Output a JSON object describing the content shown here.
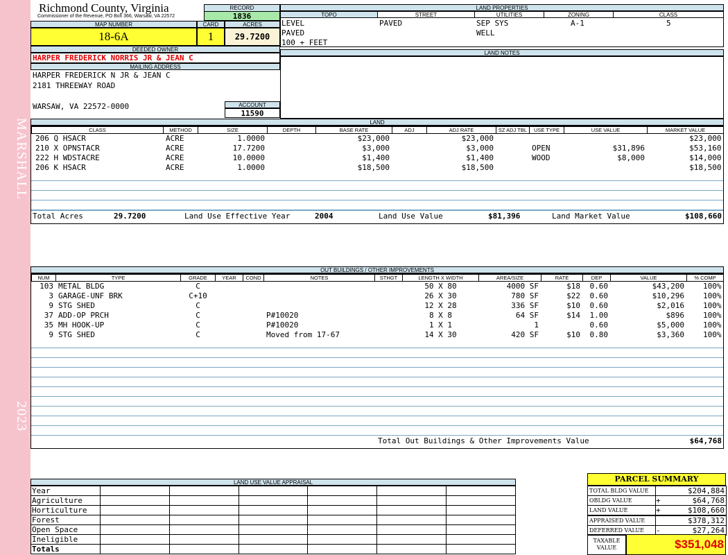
{
  "sidebar": {
    "top_text": "MARSHALL",
    "bottom_text": "2023",
    "color": "#f6c3cc"
  },
  "header": {
    "county": "Richmond County, Virginia",
    "sub": "Commissioner of the Revenue, PO Box 366, Warsaw, VA 22572",
    "record_label": "RECORD",
    "record": "1836",
    "map_number_label": "MAP NUMBER",
    "map_number": "18-6A",
    "card_label": "CARD",
    "card": "1",
    "acres_label": "ACRES",
    "acres": "29.7200"
  },
  "owner": {
    "deeded_label": "DEEDED OWNER",
    "deeded_owner": "HARPER FREDERICK NORRIS JR & JEAN C",
    "mailing_label": "MAILING ADDRESS",
    "mail_line1": "HARPER FREDERICK N JR & JEAN C",
    "mail_line2": "2181 THREEWAY ROAD",
    "mail_line3": "WARSAW, VA 22572-0000",
    "account_label": "ACCOUNT",
    "account": "11590"
  },
  "land_properties": {
    "title": "LAND PROPERTIES",
    "headers": [
      "TOPO",
      "STREET",
      "UTILITIES",
      "ZONING",
      "CLASS"
    ],
    "topo": [
      "LEVEL",
      "PAVED",
      "100 + FEET"
    ],
    "street": [
      "PAVED"
    ],
    "utilities": [
      "SEP SYS",
      "WELL"
    ],
    "zoning": "A-1",
    "class": "5"
  },
  "land_notes": {
    "title": "LAND NOTES"
  },
  "land": {
    "title": "LAND",
    "headers": [
      "CLASS",
      "METHOD",
      "SIZE",
      "DEPTH",
      "BASE RATE",
      "ADJ",
      "ADJ RATE",
      "SZ ADJ TBL",
      "USE TYPE",
      "USE VALUE",
      "MARKET VALUE"
    ],
    "rows": [
      [
        "206 Q HSACR",
        "ACRE",
        "1.0000",
        "",
        "$23,000",
        "",
        "$23,000",
        "",
        "",
        "",
        "$23,000"
      ],
      [
        "210 X OPNSTACR",
        "ACRE",
        "17.7200",
        "",
        "$3,000",
        "",
        "$3,000",
        "",
        "OPEN",
        "$31,896",
        "$53,160"
      ],
      [
        "222 H WDSTACRE",
        "ACRE",
        "10.0000",
        "",
        "$1,400",
        "",
        "$1,400",
        "",
        "WOOD",
        "$8,000",
        "$14,000"
      ],
      [
        "206 K HSACR",
        "ACRE",
        "1.0000",
        "",
        "$18,500",
        "",
        "$18,500",
        "",
        "",
        "",
        "$18,500"
      ]
    ],
    "total_acres_label": "Total Acres",
    "total_acres": "29.7200",
    "effective_year_label": "Land Use Effective Year",
    "effective_year": "2004",
    "use_value_label": "Land Use Value",
    "use_value": "$81,396",
    "market_value_label": "Land Market Value",
    "market_value": "$108,660"
  },
  "outbuildings": {
    "title": "OUT BUILDINGS / OTHER IMPROVEMENTS",
    "headers": [
      "NUM",
      "TYPE",
      "GRADE",
      "YEAR",
      "COND",
      "NOTES",
      "STHGT",
      "LENGTH X WIDTH",
      "AREA/SIZE",
      "RATE",
      "DEP",
      "VALUE",
      "% COMP"
    ],
    "rows": [
      [
        "103",
        "METAL BLDG",
        "C",
        "",
        "",
        "",
        "",
        "50 X 80",
        "4000 SF",
        "$18",
        "0.60",
        "$43,200",
        "100%"
      ],
      [
        "3",
        "GARAGE-UNF BRK",
        "C+10",
        "",
        "",
        "",
        "",
        "26 X 30",
        "780 SF",
        "$22",
        "0.60",
        "$10,296",
        "100%"
      ],
      [
        "9",
        "STG SHED",
        "C",
        "",
        "",
        "",
        "",
        "12 X 28",
        "336 SF",
        "$10",
        "0.60",
        "$2,016",
        "100%"
      ],
      [
        "37",
        "ADD-OP PRCH",
        "C",
        "",
        "",
        "P#10020",
        "",
        "8 X 8",
        "64 SF",
        "$14",
        "1.00",
        "$896",
        "100%"
      ],
      [
        "35",
        "MH HOOK-UP",
        "C",
        "",
        "",
        "P#10020",
        "",
        "1 X 1",
        "1",
        "",
        "0.60",
        "$5,000",
        "100%"
      ],
      [
        "9",
        "STG SHED",
        "C",
        "",
        "",
        "Moved from 17-67",
        "",
        "14 X 30",
        "420 SF",
        "$10",
        "0.80",
        "$3,360",
        "100%"
      ]
    ],
    "total_label": "Total Out Buildings & Other Improvements Value",
    "total": "$64,768"
  },
  "land_use_appraisal": {
    "title": "LAND USE VALUE APPRAISAL",
    "rows": [
      "Year",
      "Agriculture",
      "Horticulture",
      "Forest",
      "Open Space",
      "Ineligible",
      "Totals"
    ]
  },
  "parcel_summary": {
    "title": "PARCEL SUMMARY",
    "rows": [
      {
        "label": "TOTAL BLDG VALUE",
        "sign": "",
        "value": "$204,884"
      },
      {
        "label": "OBLDG VALUE",
        "sign": "+",
        "value": "$64,768"
      },
      {
        "label": "LAND VALUE",
        "sign": "+",
        "value": "$108,660"
      },
      {
        "label": "APPRAISED VALUE",
        "sign": "",
        "value": "$378,312"
      },
      {
        "label": "DEFERRED VALUE",
        "sign": "-",
        "value": "$27,264"
      }
    ],
    "taxable_label": "TAXABLE VALUE",
    "taxable_value": "$351,048",
    "accent_yellow": "#ffff33",
    "accent_red": "#e00000"
  }
}
